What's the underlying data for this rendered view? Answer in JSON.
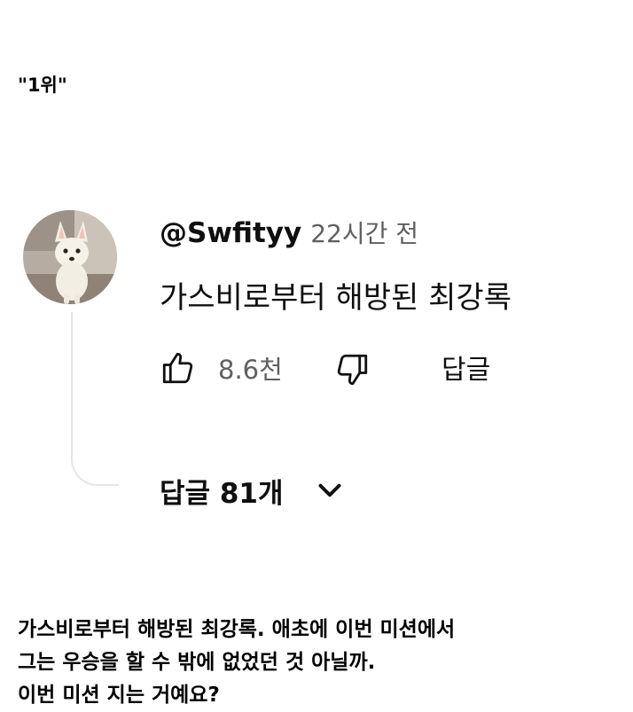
{
  "rank_label": "\"1위\"",
  "comment": {
    "username": "@Swfityy",
    "timestamp": "22시간 전",
    "text": "가스비로부터 해방된 최강록",
    "like_count": "8.6천",
    "reply_button": "답글",
    "replies_toggle": "답글 81개"
  },
  "icons": {
    "like": "thumbs-up-icon",
    "dislike": "thumbs-down-icon",
    "expand": "chevron-down-icon",
    "avatar": "dog-avatar"
  },
  "caption": {
    "line1": "가스비로부터 해방된 최강록. 애초에 이번 미션에서",
    "line2": "그는 우승을 할 수 밖에 없었던 것 아닐까.",
    "line3": "이번 미션 지는 거예요?"
  },
  "colors": {
    "primary_text": "#0f0f0f",
    "secondary_text": "#606060",
    "thread_line": "#e5e5e5",
    "background": "#ffffff"
  }
}
